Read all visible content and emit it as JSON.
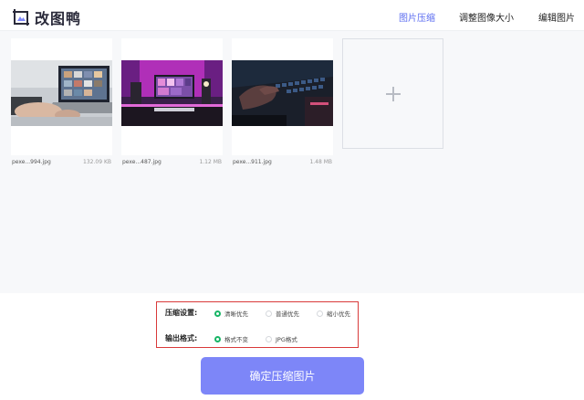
{
  "header": {
    "logo_text": "改图鸭",
    "nav": [
      {
        "label": "图片压缩",
        "active": true
      },
      {
        "label": "调整图像大小",
        "active": false
      },
      {
        "label": "编辑图片",
        "active": false
      }
    ]
  },
  "files": [
    {
      "name": "pexe...994.jpg",
      "size": "132.09 KB"
    },
    {
      "name": "pexe...487.jpg",
      "size": "1.12 MB"
    },
    {
      "name": "pexe...911.jpg",
      "size": "1.48 MB"
    }
  ],
  "settings": {
    "compress_label": "压缩设置:",
    "compress_options": [
      "清晰优先",
      "普通优先",
      "缩小优先"
    ],
    "compress_selected": "清晰优先",
    "format_label": "输出格式:",
    "format_options": [
      "格式不变",
      "JPG格式"
    ],
    "format_selected": "格式不变"
  },
  "submit_label": "确定压缩图片",
  "colors": {
    "accent": "#5b6cf0",
    "button": "#7d86f8",
    "radio_on": "#18b566",
    "highlight_border": "#d93a3a"
  }
}
